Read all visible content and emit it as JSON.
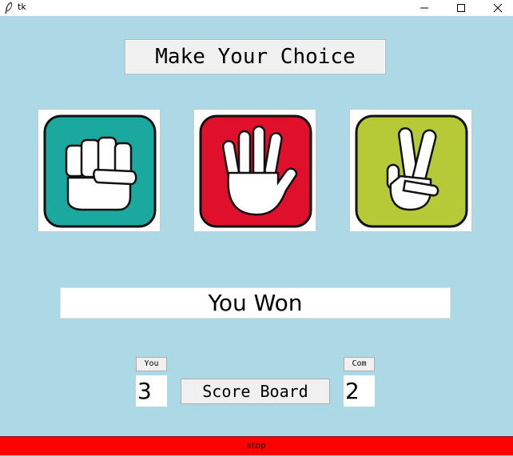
{
  "window": {
    "title": "tk",
    "icons": [
      "feather-icon",
      "minimize-icon",
      "maximize-icon",
      "close-icon"
    ]
  },
  "heading": "Make Your Choice",
  "choices": [
    {
      "name": "rock",
      "icon": "fist-icon",
      "color": "#1BA89F"
    },
    {
      "name": "paper",
      "icon": "open-hand-icon",
      "color": "#E0102C"
    },
    {
      "name": "scissors",
      "icon": "peace-sign-icon",
      "color": "#B5CA36"
    }
  ],
  "result": "You Won",
  "score": {
    "you_label": "You",
    "com_label": "Com",
    "you_value": "3",
    "com_value": "2",
    "board_label": "Score Board"
  },
  "stop_label": "stop",
  "colors": {
    "background": "#ADD8E6",
    "stop_bar": "#FF0000",
    "button_face": "#F0F0F0"
  }
}
